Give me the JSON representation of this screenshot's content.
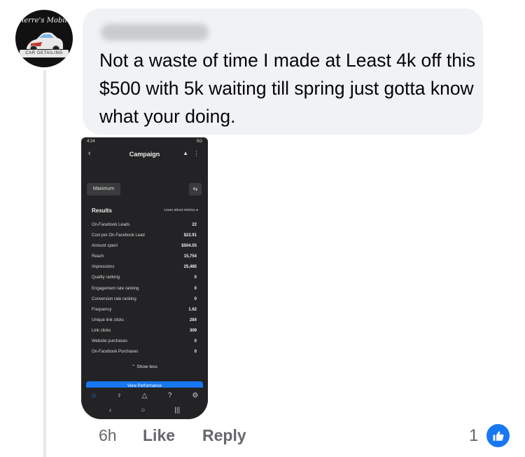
{
  "avatar": {
    "script_text": "Pierre's Mobile",
    "band_text": "CAR DETAILING"
  },
  "comment": {
    "author_name": "Justin Pierre",
    "text": "Not a waste of time I made at Least 4k off this $500 with 5k waiting till spring just gotta know what your doing."
  },
  "phone": {
    "status_time": "4:24",
    "status_right": "5G",
    "title": "Campaign",
    "filter_pill": "Maximum",
    "results_title": "Results",
    "learn_link": "Learn about metrics",
    "metrics": [
      {
        "label": "On-Facebook Leads",
        "value": "22"
      },
      {
        "label": "Cost per On-Facebook Lead",
        "value": "$22.91"
      },
      {
        "label": "Amount spent",
        "value": "$504.05"
      },
      {
        "label": "Reach",
        "value": "15,754"
      },
      {
        "label": "Impressions",
        "value": "25,485"
      },
      {
        "label": "Quality ranking",
        "value": "0"
      },
      {
        "label": "Engagement rate ranking",
        "value": "0"
      },
      {
        "label": "Conversion rate ranking",
        "value": "0"
      },
      {
        "label": "Frequency",
        "value": "1.62"
      },
      {
        "label": "Unique link clicks",
        "value": "284"
      },
      {
        "label": "Link clicks",
        "value": "309"
      },
      {
        "label": "Website purchases",
        "value": "0"
      },
      {
        "label": "On-Facebook Purchases",
        "value": "0"
      }
    ],
    "show_less": "Show less",
    "blue_button": "View Performance"
  },
  "footer": {
    "time": "6h",
    "like": "Like",
    "reply": "Reply",
    "reaction_count": "1"
  },
  "colors": {
    "accent": "#1877f2",
    "bubble_bg": "#f0f2f5",
    "meta_text": "#65676b"
  }
}
